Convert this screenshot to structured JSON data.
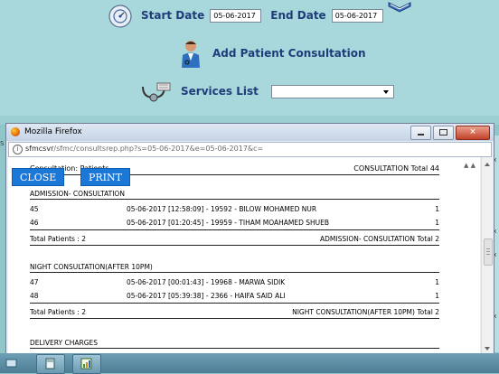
{
  "background_app": {
    "start_date_label": "Start Date",
    "start_date_value": "05-06-2017",
    "end_date_label": "End Date",
    "end_date_value": "05-06-2017",
    "add_consultation_label": "Add Patient Consultation",
    "services_list_label": "Services List",
    "services_list_value": ""
  },
  "browser": {
    "title": "Mozilla Firefox",
    "url_host": "sfmcsvr",
    "url_path": "/sfmc/consultsrep.php?s=05-06-2017&e=05-06-2017&c="
  },
  "toolbar": {
    "close_label": "CLOSE",
    "print_label": "PRINT"
  },
  "report": {
    "header_left": "Consultation: Patients",
    "header_right": "CONSULTATION Total 44",
    "sections": [
      {
        "title": "ADMISSION- CONSULTATION",
        "rows": [
          {
            "id": "45",
            "detail": "05-06-2017 [12:58:09] - 19592 - BILOW MOHAMED NUR",
            "count": "1"
          },
          {
            "id": "46",
            "detail": "05-06-2017 [01:20:45] - 19959 - TIHAM MOAHAMED SHUEB",
            "count": "1"
          }
        ],
        "total_left": "Total Patients : 2",
        "total_right": "ADMISSION- CONSULTATION Total 2"
      },
      {
        "title": "NIGHT CONSULTATION(AFTER 10PM)",
        "rows": [
          {
            "id": "47",
            "detail": "05-06-2017 [00:01:43] - 19968 - MARWA SIDIK",
            "count": "1"
          },
          {
            "id": "48",
            "detail": "05-06-2017 [05:39:38] - 2366 - HAIFA SAID ALI",
            "count": "1"
          }
        ],
        "total_left": "Total Patients : 2",
        "total_right": "NIGHT CONSULTATION(AFTER 10PM) Total 2"
      },
      {
        "title": "DELIVERY CHARGES",
        "rows": []
      }
    ]
  },
  "side_fragments": [
    "S",
    "Tx",
    "Tx",
    "Tx",
    "Tx"
  ]
}
